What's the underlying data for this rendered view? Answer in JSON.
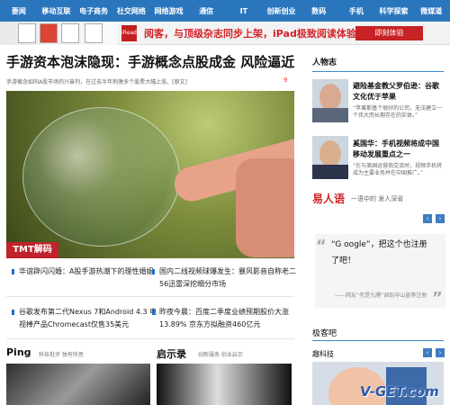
{
  "navigation": [
    "要闻",
    "移动互联",
    "电子商务",
    "社交网络",
    "网络游戏",
    "通信",
    "IT",
    "创新创业",
    "数码",
    "手机",
    "科学探索",
    "微媒道"
  ],
  "banner": {
    "brand": "iRead",
    "slogan": "阅客，与顶级杂志同步上架，iPad极致阅读体验",
    "button": "即刻体验"
  },
  "headline": "手游资本泡沫隐现：手游概念点股成金 风险逼近",
  "summary": "手游概念如同A股市场的兴奋剂，在过去半年刺激多个股票大幅上涨。[原文]",
  "comment_count": "9",
  "badge": "TMT解码",
  "news": [
    [
      "华谊辟闪闪婚：A股手游热潮下的理性婚姻",
      "国内二线视频球爆发生：暴风影音自称老二 56迅雷深挖细分市场"
    ],
    [
      "谷歌发布第二代Nexus 7和Android 4.3 电视棒产品Chromecast仅售35美元",
      "昨夜今晨：百度二季度业绩预期股价大涨13.89% 京东方拟融资460亿元"
    ]
  ],
  "bottom": {
    "ping": "Ping",
    "ping_sub": "科技批评 独有所思",
    "enlight": "启示录",
    "enlight_sub": "创新服务 创业启示"
  },
  "people": {
    "title": "人物志",
    "items": [
      {
        "head": "避险基金教父罗伯逊：谷歌文化优于苹果",
        "desc": "“苹果斯基个很好的公司，无法建立一个伟大而长期存在的实体。”"
      },
      {
        "head": "奚国华：手机视频将成中国移动发展重点之一",
        "desc": "“在与美国运营商交流时，视频手机将成为主要业务并在中国推广。”"
      }
    ]
  },
  "lumen": {
    "title": "易人语",
    "subtitle": "一语中的 发人深省",
    "quote": "“G oogle”，把这个也注册了吧！",
    "source": "——网友“老是九膊”调侃中山盖等注册"
  },
  "blogs": "极客吧",
  "source": "趣科技",
  "watermark": "V-GET.com"
}
